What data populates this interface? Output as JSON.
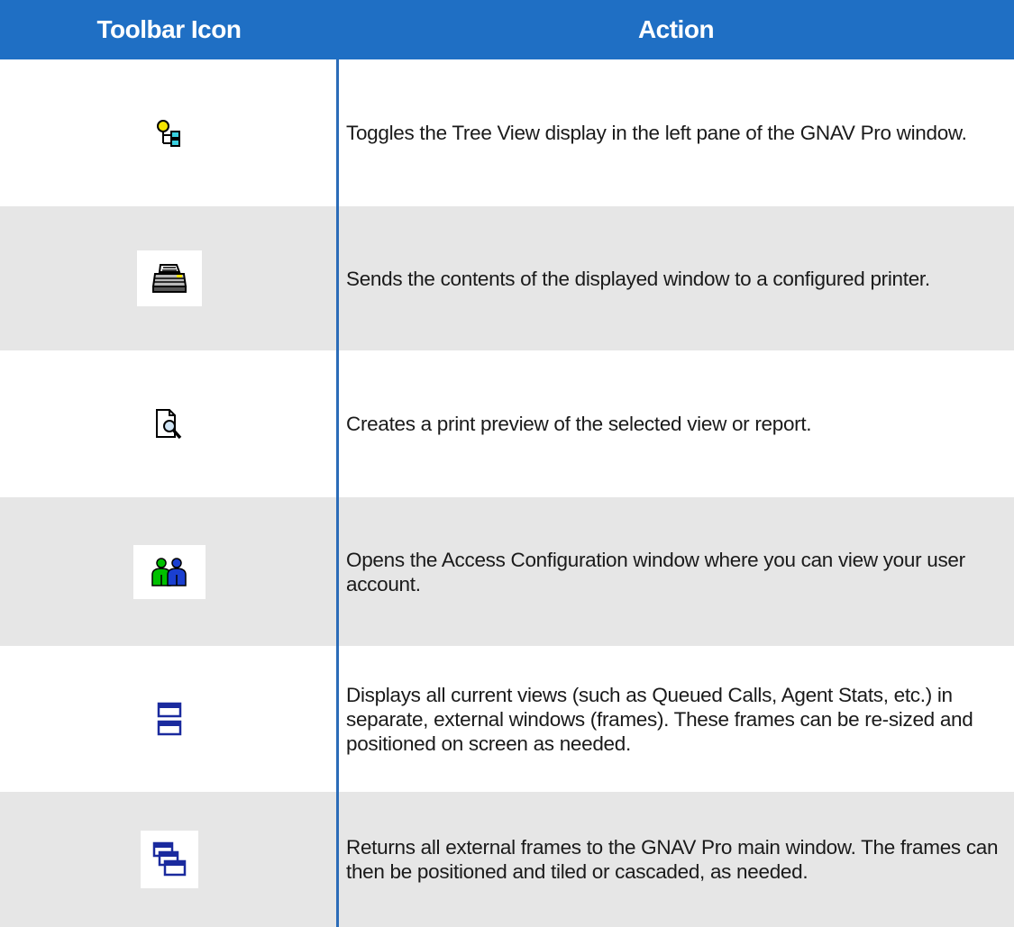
{
  "header": {
    "col_icon": "Toolbar Icon",
    "col_action": "Action"
  },
  "rows": [
    {
      "icon": "tree-view-icon",
      "action": "Toggles the Tree View display in the left pane of the GNAV Pro window."
    },
    {
      "icon": "printer-icon",
      "action": "Sends the contents of the displayed window to a configured printer."
    },
    {
      "icon": "print-preview-icon",
      "action": "Creates a print preview of the selected view or report."
    },
    {
      "icon": "users-icon",
      "action": "Opens the Access Configuration window where you can view your user account."
    },
    {
      "icon": "separate-frames-icon",
      "action": "Displays all current views (such as Queued Calls, Agent Stats, etc.) in separate, external windows (frames). These frames can be re-sized and positioned on screen as needed."
    },
    {
      "icon": "cascade-frames-icon",
      "action": "Returns all external frames to the GNAV Pro main window. The frames can then be positioned and tiled or cascaded, as needed."
    }
  ],
  "colors": {
    "header_bg": "#1f6fc4",
    "row_shade": "#e6e6e6",
    "divider": "#2b6cb8"
  }
}
